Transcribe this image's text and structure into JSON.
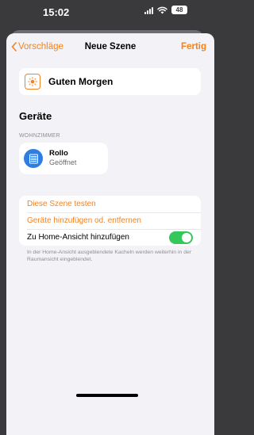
{
  "status_bar": {
    "time": "15:02",
    "battery": "48"
  },
  "nav": {
    "back_label": "Vorschläge",
    "title": "Neue Szene",
    "done_label": "Fertig"
  },
  "scene": {
    "name": "Guten Morgen",
    "icon": "sun-icon"
  },
  "devices_section": {
    "title": "Geräte",
    "room": "WOHNZIMMER",
    "devices": [
      {
        "name": "Rollo",
        "status": "Geöffnet",
        "icon": "blinds-icon"
      }
    ]
  },
  "actions": {
    "test_scene": "Diese Szene testen",
    "edit_devices": "Geräte hinzufügen od. entfernen",
    "add_to_home": "Zu Home-Ansicht hinzufügen",
    "add_to_home_enabled": true
  },
  "footnote": "In der Home-Ansicht ausgeblendete Kacheln werden weiterhin in der Raumansicht eingeblendet.",
  "colors": {
    "accent": "#f4821f",
    "toggle_on": "#34c759",
    "device_icon": "#2e7de0"
  }
}
